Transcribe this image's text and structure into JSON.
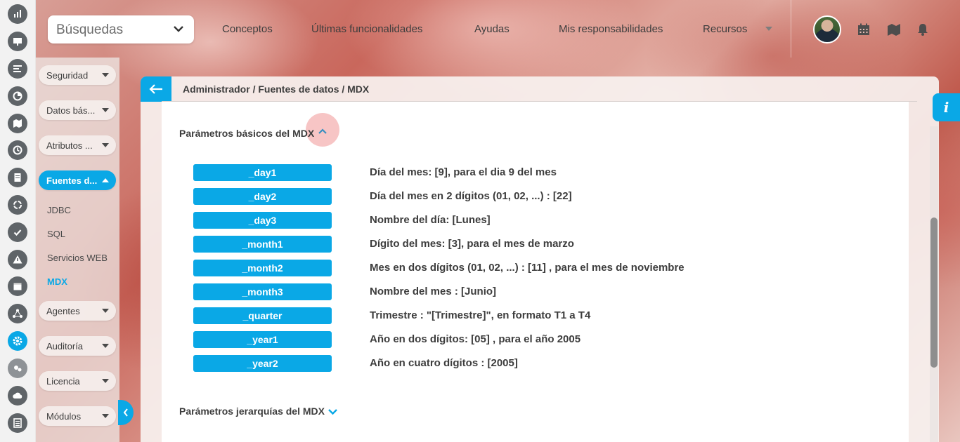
{
  "topbar": {
    "search_label": "Búsquedas",
    "nav": [
      "Conceptos",
      "Últimas funcionalidades",
      "Ayudas",
      "Mis responsabilidades",
      "Recursos"
    ]
  },
  "sidebar": {
    "menus": [
      {
        "label": "Seguridad"
      },
      {
        "label": "Datos bás..."
      },
      {
        "label": "Atributos ..."
      },
      {
        "label": "Fuentes d..."
      },
      {
        "label": "Agentes"
      },
      {
        "label": "Auditoría"
      },
      {
        "label": "Licencia"
      },
      {
        "label": "Módulos"
      }
    ],
    "subitems": [
      "JDBC",
      "SQL",
      "Servicios WEB",
      "MDX"
    ]
  },
  "breadcrumb": "Administrador / Fuentes de datos / MDX",
  "sections": {
    "basic": "Parámetros básicos del MDX",
    "hierarchy": "Parámetros jerarquías del MDX"
  },
  "params": [
    {
      "name": "_day1",
      "desc": "Día del mes: [9], para el dia 9 del mes"
    },
    {
      "name": "_day2",
      "desc": "Día del mes en 2 dígitos (01, 02, ...) : [22]"
    },
    {
      "name": "_day3",
      "desc": "Nombre del día: [Lunes]"
    },
    {
      "name": "_month1",
      "desc": "Dígito del mes: [3], para el mes de marzo"
    },
    {
      "name": "_month2",
      "desc": "Mes en dos dígitos (01, 02, ...) : [11] , para el mes de noviembre"
    },
    {
      "name": "_month3",
      "desc": "Nombre del mes : [Junio]"
    },
    {
      "name": "_quarter",
      "desc": "Trimestre : \"[Trimestre]\", en formato T1 a T4"
    },
    {
      "name": "_year1",
      "desc": "Año en dos dígitos: [05] , para el año 2005"
    },
    {
      "name": "_year2",
      "desc": "Año en cuatro dígitos : [2005]"
    }
  ],
  "info_label": "i",
  "colors": {
    "accent": "#0aa8e6",
    "text": "#3d3d3d",
    "rail_icon": "#5f6468"
  }
}
